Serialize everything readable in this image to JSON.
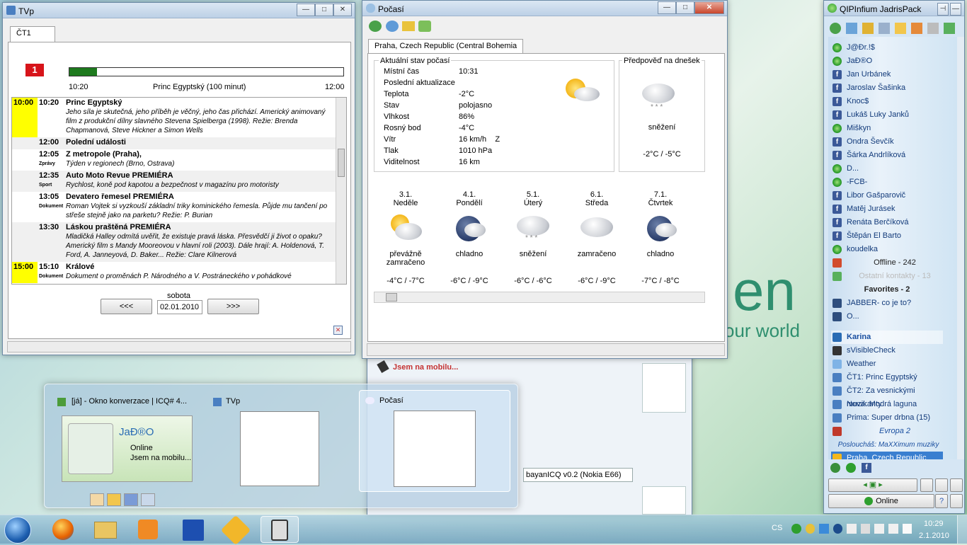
{
  "desktop": {
    "text1": "en",
    "text2": "your world"
  },
  "tvp": {
    "title": "TVp",
    "tab": "ČT1",
    "channel_logo": "1",
    "progress": 0.1,
    "time_start": "10:20",
    "now_show": "Princ Egyptský  (100 minut)",
    "time_end": "12:00",
    "programs": [
      {
        "slot": "10:00",
        "time": "10:20",
        "tag": "",
        "name": "Princ Egyptský",
        "desc": "Jeho síla je skutečná, jeho příběh je věčný, jeho čas přichází. Americký animovaný film z produkční dílny slavného Stevena Spielberga (1998). Režie: Brenda Chapmanová, Steve Hickner a Simon Wells"
      },
      {
        "slot": "",
        "time": "12:00",
        "tag": "",
        "name": "Polední události",
        "desc": ""
      },
      {
        "slot": "",
        "time": "12:05",
        "tag": "Zprávy",
        "name": "Z metropole (Praha),",
        "desc": "Týden v regionech (Brno, Ostrava)"
      },
      {
        "slot": "",
        "time": "12:35",
        "tag": "Sport",
        "name": "Auto Moto Revue PREMIÉRA",
        "desc": "Rychlost, koně pod kapotou a bezpečnost v magazínu pro motoristy"
      },
      {
        "slot": "",
        "time": "13:05",
        "tag": "Dokument",
        "name": "Devatero řemesel PREMIÉRA",
        "desc": "Roman Vojtek si vyzkouší základní triky kominického řemesla. Půjde mu tančení po střeše stejně jako na parketu? Režie: P. Burian"
      },
      {
        "slot": "",
        "time": "13:30",
        "tag": "",
        "name": "Láskou praštěná PREMIÉRA",
        "desc": "Mladičká Halley odmítá uvěřit, že existuje pravá láska. Přesvědčí ji život o opaku? Americký film s Mandy Mooreovou v hlavní roli (2003). Dále hrají: A. Holdenová, T. Ford, A. Janneyová, D. Baker... Režie: Clare Kilnerová"
      },
      {
        "slot": "15:00",
        "time": "15:10",
        "tag": "Dokument",
        "name": "Králové",
        "desc": "Dokument o proměnách P. Národného a V. Postráneckého v pohádkové"
      }
    ],
    "day_label": "sobota",
    "prev": "<<<",
    "date": "02.01.2010",
    "next": ">>>"
  },
  "weather": {
    "title": "Počasí",
    "tab": "Praha, Czech Republic (Central Bohemia",
    "current_title": "Aktuální stav počasí",
    "rows": [
      {
        "k": "Místní čas",
        "v": "10:31"
      },
      {
        "k": "Poslední aktualizace",
        "v": ""
      },
      {
        "k": "Teplota",
        "v": "-2°C"
      },
      {
        "k": "Stav",
        "v": "polojasno"
      },
      {
        "k": "Vlhkost",
        "v": "86%"
      },
      {
        "k": "Rosný bod",
        "v": "-4°C"
      },
      {
        "k": "Vítr",
        "v": "16 km/h    Z"
      },
      {
        "k": "Tlak",
        "v": "1010 hPa"
      },
      {
        "k": "Viditelnost",
        "v": "16 km"
      }
    ],
    "today_title": "Předpověď na dnešek",
    "today_cond": "sněžení",
    "today_temp": "-2°C / -5°C",
    "days": [
      {
        "date": "3.1.",
        "name": "Neděle",
        "cond": "převážně zamračeno",
        "temp": "-4°C / -7°C",
        "icon": "sun-cloud"
      },
      {
        "date": "4.1.",
        "name": "Pondělí",
        "cond": "chladno",
        "temp": "-6°C / -9°C",
        "icon": "storm"
      },
      {
        "date": "5.1.",
        "name": "Úterý",
        "cond": "sněžení",
        "temp": "-6°C / -6°C",
        "icon": "snow"
      },
      {
        "date": "6.1.",
        "name": "Středa",
        "cond": "zamračeno",
        "temp": "-6°C / -9°C",
        "icon": "cloud"
      },
      {
        "date": "7.1.",
        "name": "Čtvrtek",
        "cond": "chladno",
        "temp": "-7°C / -8°C",
        "icon": "storm"
      }
    ]
  },
  "qip": {
    "title": "QIPInfium JadrisPack",
    "contacts": [
      {
        "name": "J@Đr.!$",
        "icon": "flower"
      },
      {
        "name": "JaĐ®O",
        "icon": "flower"
      },
      {
        "name": "Jan Urbánek",
        "icon": "fb"
      },
      {
        "name": "Jaroslav Šašinka",
        "icon": "fb"
      },
      {
        "name": "Knoc$",
        "icon": "fb"
      },
      {
        "name": "Lukáš Luky Janků",
        "icon": "fb"
      },
      {
        "name": "Miškyn",
        "icon": "flower"
      },
      {
        "name": "Ondra Ševčík",
        "icon": "fb"
      },
      {
        "name": "Šárka Andrlíková",
        "icon": "fb"
      },
      {
        "name": "D...",
        "icon": "flower"
      },
      {
        "name": "-FCB-",
        "icon": "flower"
      },
      {
        "name": "Libor Gašparovič",
        "icon": "fb"
      },
      {
        "name": "Matěj Jurásek",
        "icon": "fb"
      },
      {
        "name": "Renáta Berčíková",
        "icon": "fb"
      },
      {
        "name": "Štěpán El Barto",
        "icon": "fb"
      },
      {
        "name": "koudelka",
        "icon": "flower"
      }
    ],
    "offline_label": "Offline - 242",
    "other_label": "Ostatní kontakty - 13",
    "favorites_label": "Favorites - 2",
    "favorites": [
      "JABBER- co je to?",
      "O..."
    ],
    "account": "Karina",
    "plugins": [
      "sVisibleCheck",
      "Weather",
      "ČT1: Princ Egyptský",
      "ČT2: Za vesnickými muzikanty",
      "Nova: Modrá laguna",
      "Prima: Super drbna (15)"
    ],
    "radio": "Evropa 2",
    "listening": "Posloucháš: MaXXimum muziky",
    "weather_item": "Praha, Czech Republic (Centra",
    "status": "Online"
  },
  "behind": {
    "mobile_text": "Jsem na mobilu...",
    "client": "bayanICQ v0.2 (Nokia E66)"
  },
  "taskpreview": {
    "items": [
      {
        "title": "[já] - Okno konverzace | ICQ# 4...",
        "name": "JaĐ®O",
        "line1": "Online",
        "line2": "Jsem na mobilu..."
      },
      {
        "title": "TVp"
      },
      {
        "title": "Počasí"
      }
    ]
  },
  "tray": {
    "lang": "CS",
    "time": "10:29",
    "date": "2.1.2010"
  }
}
